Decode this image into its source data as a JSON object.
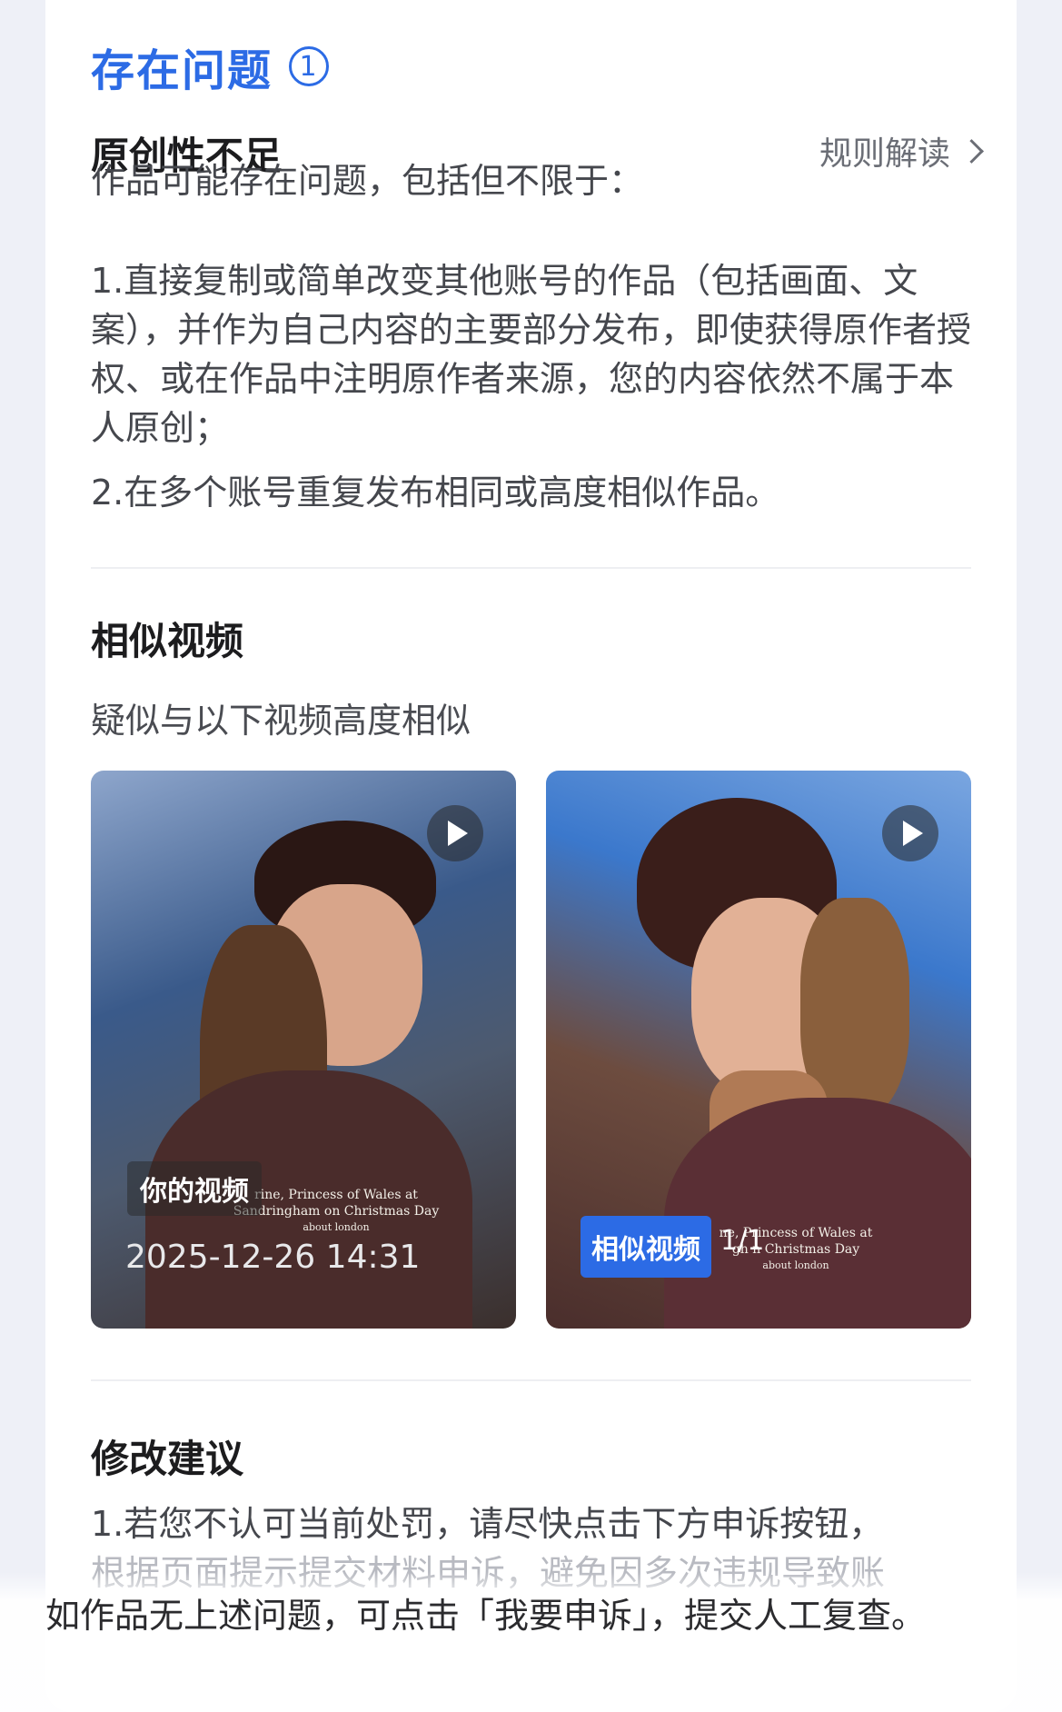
{
  "issues": {
    "title": "存在问题",
    "count": "1"
  },
  "issue": {
    "title": "原创性不足",
    "rule_link": "规则解读",
    "intro": "作品可能存在问题，包括但不限于：",
    "point1": "1.直接复制或简单改变其他账号的作品（包括画面、文案），并作为自己内容的主要部分发布，即使获得原作者授权、或在作品中注明原作者来源，您的内容依然不属于本人原创；",
    "point2": "2.在多个账号重复发布相同或高度相似作品。"
  },
  "similar": {
    "title": "相似视频",
    "subtitle": "疑似与以下视频高度相似",
    "left": {
      "tag": "你的视频",
      "date": "2025-12-26 14:31",
      "caption_line1": "rine, Princess of Wales at",
      "caption_line2": "Sandringham on Christmas Day",
      "caption_line3": "about london"
    },
    "right": {
      "tag": "相似视频",
      "counter": "1/1",
      "caption_line1": "ne, Princess of Wales at",
      "caption_line2": "gh   n Christmas Day",
      "caption_line3": "about london"
    }
  },
  "suggestion": {
    "title": "修改建议",
    "line1": "1.若您不认可当前处罚，请尽快点击下方申诉按钮，",
    "line2_faded": "根据页面提示提交材料申诉，避免因多次违规导致账"
  },
  "overlay": {
    "text": "如作品无上述问题，可点击「我要申诉」，提交人工复查。"
  },
  "colors": {
    "accent": "#2c6be5",
    "background": "#eef0f7",
    "card": "#ffffff"
  }
}
